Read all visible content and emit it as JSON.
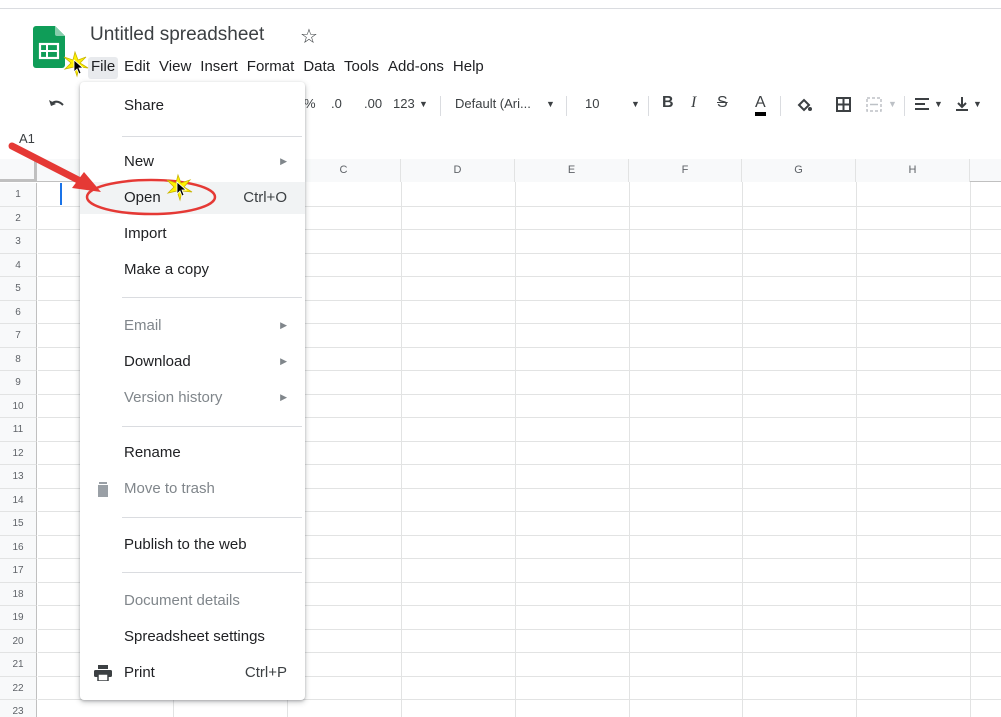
{
  "app": {
    "title": "Untitled spreadsheet"
  },
  "menubar": {
    "items": [
      "File",
      "Edit",
      "View",
      "Insert",
      "Format",
      "Data",
      "Tools",
      "Add-ons",
      "Help"
    ]
  },
  "toolbar": {
    "percent": "%",
    "decimal_decrease": ".0",
    "decimal_increase": ".00",
    "more_formats": "123",
    "font": "Default (Ari...",
    "font_size": "10",
    "bold": "B",
    "italic": "I",
    "strikethrough": "S",
    "text_color": "A"
  },
  "name_box": "A1",
  "grid": {
    "columns": [
      "C",
      "D",
      "E",
      "F",
      "G",
      "H"
    ],
    "rows": [
      "1",
      "2",
      "3",
      "4",
      "5",
      "6",
      "7",
      "8",
      "9",
      "10",
      "11",
      "12",
      "13",
      "14",
      "15",
      "16",
      "17",
      "18",
      "19",
      "20",
      "21",
      "22",
      "23"
    ]
  },
  "file_menu": {
    "items": [
      {
        "label": "Share",
        "shortcut": "",
        "submenu": false,
        "disabled": false
      },
      {
        "label": "New",
        "shortcut": "",
        "submenu": true,
        "disabled": false
      },
      {
        "label": "Open",
        "shortcut": "Ctrl+O",
        "submenu": false,
        "disabled": false
      },
      {
        "label": "Import",
        "shortcut": "",
        "submenu": false,
        "disabled": false
      },
      {
        "label": "Make a copy",
        "shortcut": "",
        "submenu": false,
        "disabled": false
      },
      {
        "label": "Email",
        "shortcut": "",
        "submenu": true,
        "disabled": true
      },
      {
        "label": "Download",
        "shortcut": "",
        "submenu": true,
        "disabled": false
      },
      {
        "label": "Version history",
        "shortcut": "",
        "submenu": true,
        "disabled": true
      },
      {
        "label": "Rename",
        "shortcut": "",
        "submenu": false,
        "disabled": false
      },
      {
        "label": "Move to trash",
        "shortcut": "",
        "submenu": false,
        "disabled": true,
        "icon": "trash-icon"
      },
      {
        "label": "Publish to the web",
        "shortcut": "",
        "submenu": false,
        "disabled": false
      },
      {
        "label": "Document details",
        "shortcut": "",
        "submenu": false,
        "disabled": true
      },
      {
        "label": "Spreadsheet settings",
        "shortcut": "",
        "submenu": false,
        "disabled": false
      },
      {
        "label": "Print",
        "shortcut": "Ctrl+P",
        "submenu": false,
        "disabled": false,
        "icon": "print-icon"
      }
    ]
  },
  "colors": {
    "logo_green": "#0f9d58",
    "selection_blue": "#1a73e8",
    "annotation_red": "#e53935",
    "highlight_yellow": "#fff200"
  }
}
